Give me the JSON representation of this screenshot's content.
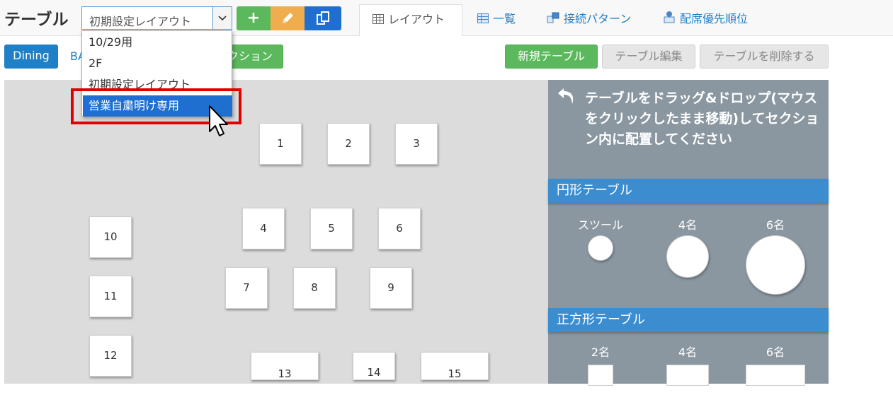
{
  "header": {
    "title": "テーブル",
    "layout_select_value": "初期設定レイアウト"
  },
  "toolbar": {
    "add_label": "+",
    "edit_icon": "pencil-icon",
    "copy_icon": "copy-icon"
  },
  "tabs": [
    {
      "label": "レイアウト",
      "icon": "grid-icon",
      "active": true
    },
    {
      "label": "一覧",
      "icon": "list-icon",
      "active": false
    },
    {
      "label": "接続パターン",
      "icon": "connect-icon",
      "active": false
    },
    {
      "label": "配席優先順位",
      "icon": "priority-icon",
      "active": false
    }
  ],
  "sections": {
    "dining": "Dining",
    "ba_partial": "BA",
    "add_section_partial": "クション"
  },
  "actions": {
    "new_table": "新規テーブル",
    "edit_table": "テーブル編集",
    "delete_table": "テーブルを削除する"
  },
  "dropdown": {
    "options": [
      "10/29用",
      "2F",
      "初期設定レイアウト",
      "営業自粛明け専用"
    ],
    "selected_index": 3
  },
  "tables": [
    "1",
    "2",
    "3",
    "4",
    "5",
    "6",
    "7",
    "8",
    "9",
    "10",
    "11",
    "12",
    "13",
    "14",
    "15"
  ],
  "panel": {
    "title": "テーブルをドラッグ&ドロップ(マウスをクリックしたまま移動)してセクション内に配置してください",
    "round_heading": "円形テーブル",
    "round_items": [
      "スツール",
      "4名",
      "6名"
    ],
    "square_heading": "正方形テーブル",
    "square_items": [
      "2名",
      "4名",
      "6名"
    ]
  },
  "colors": {
    "green": "#5cb85c",
    "orange": "#f0ad4e",
    "blue": "#1e6fd0",
    "highlight": "#e00000"
  }
}
